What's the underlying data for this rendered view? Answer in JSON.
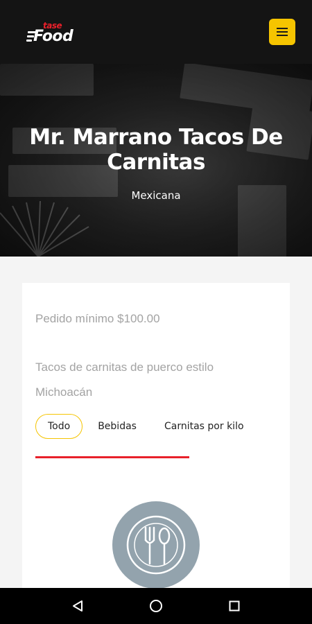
{
  "header": {
    "logo_small_text": "tase",
    "logo_big_text": "Food",
    "menu_icon": "hamburger-menu-icon"
  },
  "restaurant": {
    "name": "Mr. Marrano Tacos De Carnitas",
    "cuisine": "Mexicana",
    "min_order": "Pedido mínimo $100.00",
    "description": "Tacos de carnitas de puerco estilo Michoacán"
  },
  "tabs": [
    {
      "label": "Todo",
      "active": true
    },
    {
      "label": "Bebidas",
      "active": false
    },
    {
      "label": "Carnitas por kilo",
      "active": false
    }
  ],
  "placeholder_icon": "plate-fork-spoon-icon",
  "system_nav": {
    "back_icon": "back-triangle-icon",
    "home_icon": "home-circle-icon",
    "recents_icon": "recents-square-icon"
  },
  "colors": {
    "accent_yellow": "#f5c400",
    "accent_red": "#e8202a",
    "topbar": "#141414",
    "placeholder_circle": "#93a3ad"
  }
}
